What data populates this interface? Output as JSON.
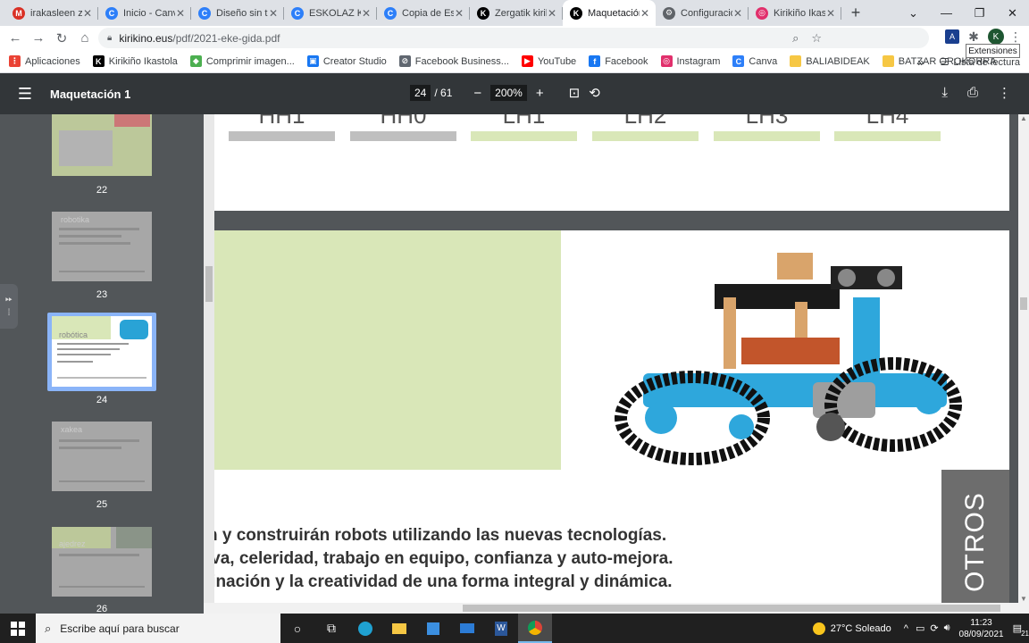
{
  "tabs": [
    {
      "label": "irakasleen ze",
      "icon": "gmail-icon",
      "color": "#d93025",
      "glyph": "M"
    },
    {
      "label": "Inicio - Canv",
      "icon": "canva-icon",
      "color": "#2d7ff9",
      "glyph": "C"
    },
    {
      "label": "Diseño sin tí",
      "icon": "canva-icon",
      "color": "#2d7ff9",
      "glyph": "C"
    },
    {
      "label": "ESKOLAZ Kir",
      "icon": "canva-icon",
      "color": "#2d7ff9",
      "glyph": "C"
    },
    {
      "label": "Copia de Esk",
      "icon": "canva-icon",
      "color": "#2d7ff9",
      "glyph": "C"
    },
    {
      "label": "Zergatik kirik",
      "icon": "kirikino-icon",
      "color": "#000000",
      "glyph": "K"
    },
    {
      "label": "Maquetación",
      "icon": "kirikino-icon",
      "color": "#000000",
      "glyph": "K",
      "active": true
    },
    {
      "label": "Configuración",
      "icon": "settings-icon",
      "color": "#5f6368",
      "glyph": "⚙"
    },
    {
      "label": "Kirikiño Ikast",
      "icon": "instagram-icon",
      "color": "#e1306c",
      "glyph": "◎"
    }
  ],
  "address": {
    "domain": "kirikino.eus",
    "path": "/pdf/2021-eke-gida.pdf"
  },
  "tooltip": "Extensiones",
  "profile_initial": "K",
  "bookmarks": [
    {
      "label": "Aplicaciones",
      "icon": "apps-grid-icon",
      "color": "#ea4335",
      "glyph": "⋮"
    },
    {
      "label": "Kirikiño Ikastola",
      "icon": "kirikino-icon",
      "color": "#000000",
      "glyph": "K"
    },
    {
      "label": "Comprimir imagen...",
      "icon": "compress-icon",
      "color": "#4caf50",
      "glyph": "◆"
    },
    {
      "label": "Creator Studio",
      "icon": "creator-studio-icon",
      "color": "#1877f2",
      "glyph": "▣"
    },
    {
      "label": "Facebook Business...",
      "icon": "facebook-business-icon",
      "color": "#606770",
      "glyph": "⊘"
    },
    {
      "label": "YouTube",
      "icon": "youtube-icon",
      "color": "#ff0000",
      "glyph": "▶"
    },
    {
      "label": "Facebook",
      "icon": "facebook-icon",
      "color": "#1877f2",
      "glyph": "f"
    },
    {
      "label": "Instagram",
      "icon": "instagram-icon",
      "color": "#e1306c",
      "glyph": "◎"
    },
    {
      "label": "Canva",
      "icon": "canva-icon",
      "color": "#2d7ff9",
      "glyph": "C"
    },
    {
      "label": "BALIABIDEAK",
      "icon": "folder-icon",
      "color": "#f6c744",
      "glyph": ""
    },
    {
      "label": "BATZAR OROKORRA",
      "icon": "folder-icon",
      "color": "#f6c744",
      "glyph": ""
    }
  ],
  "bookmarks_overflow": "»",
  "reading_list": "Lista de lectura",
  "pdf": {
    "title": "Maquetación 1",
    "current_page": "24",
    "total_pages": "/ 61",
    "zoom": "200%"
  },
  "thumbnails": [
    {
      "page": "22",
      "label": ""
    },
    {
      "page": "23",
      "label": "robotika"
    },
    {
      "page": "24",
      "label": "robótica"
    },
    {
      "page": "25",
      "label": "xakea"
    },
    {
      "page": "26",
      "label": "ajedrez"
    }
  ],
  "page_content": {
    "header_labels": [
      "HH1",
      "HH0",
      "LH1",
      "LH2",
      "LH3",
      "LH4"
    ],
    "header_bar_colors": [
      "#bfbfbf",
      "#bfbfbf",
      "#d9e7b8",
      "#d9e7b8",
      "#d9e7b8",
      "#d9e7b8"
    ],
    "description_lines": [
      "rán y construirán robots utilizando las nuevas tecnologías.",
      "ativa, celeridad, trabajo en equipo, confianza y auto-mejora.",
      "aginación y la creatividad de una forma integral y dinámica."
    ],
    "side_label": "OTROS",
    "accent_green": "#d9e7b8"
  },
  "taskbar": {
    "search_placeholder": "Escribe aquí para buscar",
    "weather": "27°C  Soleado",
    "time": "11:23",
    "date": "08/09/2021",
    "notifications": "21"
  }
}
